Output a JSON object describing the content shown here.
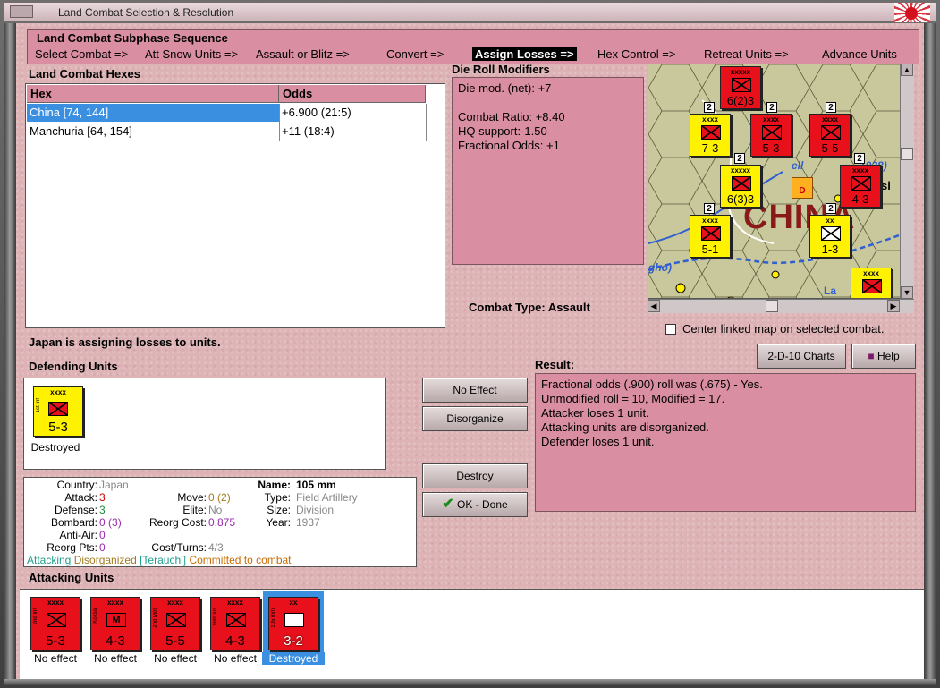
{
  "window": {
    "title": "Land Combat Selection & Resolution"
  },
  "sequence": {
    "title": "Land Combat Subphase Sequence",
    "steps": [
      "Select Combat =>",
      "Att Snow Units =>",
      "Assault or Blitz =>",
      "Convert =>",
      "Assign Losses =>",
      "Hex Control =>",
      "Retreat Units =>",
      "Advance Units"
    ],
    "active_index": 4
  },
  "hexes": {
    "label": "Land Combat Hexes",
    "col_hex": "Hex",
    "col_odds": "Odds",
    "rows": [
      {
        "hex": "China [74, 144]",
        "odds": "+6.900 (21:5)",
        "selected": true
      },
      {
        "hex": "Manchuria [64, 154]",
        "odds": "+11 (18:4)",
        "selected": false
      }
    ]
  },
  "die_mods": {
    "label": "Die Roll Modifiers",
    "lines": [
      "Die mod. (net): +7",
      "",
      "Combat Ratio: +8.40",
      "HQ support:-1.50",
      "Fractional Odds: +1"
    ]
  },
  "combat_type": {
    "label": "Combat Type:",
    "value": "Assault"
  },
  "map": {
    "center_label": "Center linked map on selected combat.",
    "place_text": "CHINA",
    "river_text_1": "ell",
    "river_text_2": "-1938)",
    "river_text_3": "gho)",
    "side_text": "si",
    "bottom_text": "La",
    "units": [
      {
        "type": "xxxxx",
        "str": "6(2)3",
        "color": "red"
      },
      {
        "type": "xxxx",
        "str": "7-3",
        "color": "yellow"
      },
      {
        "type": "xxxx",
        "str": "5-3",
        "color": "red"
      },
      {
        "type": "xxxx",
        "str": "5-5",
        "color": "red"
      },
      {
        "type": "xxxxx",
        "str": "6(3)3",
        "color": "yellow"
      },
      {
        "type": "xxxx",
        "str": "4-3",
        "color": "red"
      },
      {
        "type": "xxxx",
        "str": "5-1",
        "color": "yellow"
      },
      {
        "type": "xx",
        "str": "1-3",
        "color": "yellow"
      },
      {
        "type": "xxxx",
        "str": "",
        "color": "yellow"
      }
    ],
    "stack_counts": [
      "2",
      "2",
      "2",
      "2",
      "2",
      "2",
      "2"
    ],
    "hq_marker": "D",
    "colors": {
      "terrain": "#c8c79a",
      "red_unit": "#e8101a",
      "yellow_unit": "#fff200",
      "river": "#2f5fd0"
    }
  },
  "status": "Japan is assigning losses to units.",
  "defending": {
    "label": "Defending Units",
    "units": [
      {
        "type": "xxxx",
        "side_label": "1st Inf",
        "str": "5-3",
        "color": "yellow",
        "caption": "Destroyed"
      }
    ]
  },
  "buttons": {
    "charts": "2-D-10 Charts",
    "help": "Help",
    "no_effect": "No Effect",
    "disorganize": "Disorganize",
    "destroy": "Destroy",
    "ok_done": "OK - Done"
  },
  "result": {
    "label": "Result:",
    "lines": [
      "Fractional odds (.900) roll was (.675)  - Yes.",
      "Unmodified roll = 10, Modified = 17.",
      "Attacker loses 1 unit.",
      "Attacking units are disorganized.",
      "Defender loses 1 unit."
    ]
  },
  "info": {
    "country_label": "Country:",
    "country": "Japan",
    "attack_label": "Attack:",
    "attack": "3",
    "defense_label": "Defense:",
    "defense": "3",
    "bombard_label": "Bombard:",
    "bombard": "0",
    "bombard_paren": "(3)",
    "antiair_label": "Anti-Air:",
    "antiair": "0",
    "reorg_label": "Reorg Pts:",
    "reorg": "0",
    "move_label": "Move:",
    "move": "0",
    "move_paren": "(2)",
    "elite_label": "Elite:",
    "elite": "No",
    "reorg_cost_label": "Reorg Cost:",
    "reorg_cost": "0.875",
    "cost_turns_label": "Cost/Turns:",
    "cost_turns": "4/3",
    "name_label": "Name:",
    "name": "105 mm",
    "type_label": "Type:",
    "type": "Field Artillery",
    "size_label": "Size:",
    "size": "Division",
    "year_label": "Year:",
    "year": "1937",
    "status_attacking": "Attacking",
    "status_disorganized": "Disorganized",
    "status_leader": "[Terauchi]",
    "status_committed": "Committed to combat"
  },
  "attacking": {
    "label": "Attacking Units",
    "units": [
      {
        "type": "xxxx",
        "side_label": "2nd Inf",
        "str": "5-3",
        "caption": "No effect",
        "selected": false
      },
      {
        "type": "xxxx",
        "side_label": "Koksa",
        "str": "4-3",
        "caption": "No effect",
        "selected": false,
        "symbol": "M"
      },
      {
        "type": "xxxx",
        "side_label": "2nd Mot",
        "str": "5-5",
        "caption": "No effect",
        "selected": false
      },
      {
        "type": "xxxx",
        "side_label": "16th Inf",
        "str": "4-3",
        "caption": "No effect",
        "selected": false
      },
      {
        "type": "xx",
        "side_label": "105 mm",
        "str": "3-2",
        "caption": "Destroyed",
        "selected": true
      }
    ]
  }
}
